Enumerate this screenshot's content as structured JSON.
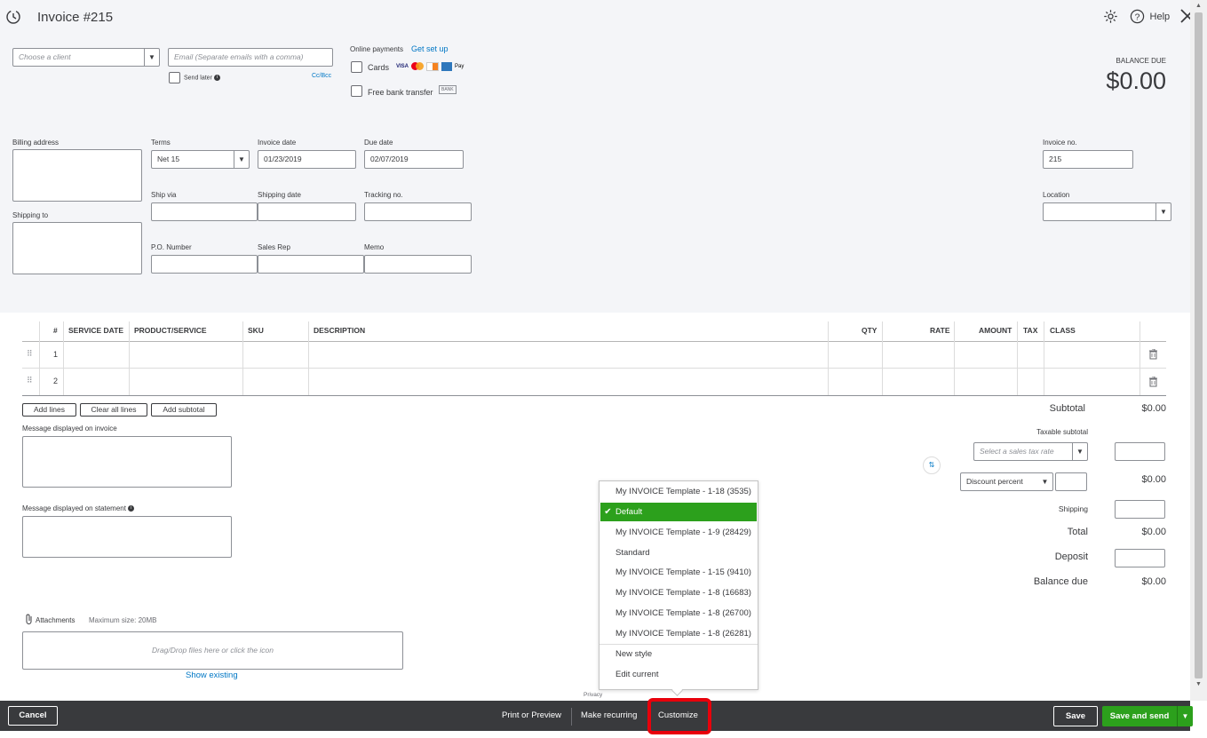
{
  "header": {
    "title": "Invoice #215",
    "help_label": "Help"
  },
  "customer": {
    "client_placeholder": "Choose a client",
    "email_placeholder": "Email (Separate emails with a comma)",
    "send_later_label": "Send later",
    "cc_bcc_label": "Cc/Bcc"
  },
  "online_payments": {
    "label": "Online payments",
    "setup_link": "Get set up",
    "cards_label": "Cards",
    "bank_label": "Free bank transfer",
    "bank_badge": "BANK",
    "card_brands": [
      "VISA",
      "MC",
      "DISC",
      "AMEX",
      "Pay"
    ]
  },
  "balance": {
    "label": "BALANCE DUE",
    "amount": "$0.00"
  },
  "fields": {
    "billing_address_label": "Billing address",
    "shipping_to_label": "Shipping to",
    "terms_label": "Terms",
    "terms_value": "Net 15",
    "invoice_date_label": "Invoice date",
    "invoice_date_value": "01/23/2019",
    "due_date_label": "Due date",
    "due_date_value": "02/07/2019",
    "ship_via_label": "Ship via",
    "shipping_date_label": "Shipping date",
    "tracking_label": "Tracking no.",
    "po_label": "P.O. Number",
    "sales_rep_label": "Sales Rep",
    "memo_label": "Memo",
    "invoice_no_label": "Invoice no.",
    "invoice_no_value": "215",
    "location_label": "Location"
  },
  "table": {
    "headers": [
      "#",
      "SERVICE DATE",
      "PRODUCT/SERVICE",
      "SKU",
      "DESCRIPTION",
      "QTY",
      "RATE",
      "AMOUNT",
      "TAX",
      "CLASS"
    ],
    "rows": [
      "1",
      "2"
    ]
  },
  "actions": {
    "add_lines": "Add lines",
    "clear_all_lines": "Clear all lines",
    "add_subtotal": "Add subtotal"
  },
  "messages": {
    "invoice_label": "Message displayed on invoice",
    "statement_label": "Message displayed on statement"
  },
  "attachments": {
    "label": "Attachments",
    "max_size": "Maximum size: 20MB",
    "drop_text": "Drag/Drop files here or click the icon",
    "show_existing": "Show existing"
  },
  "totals": {
    "subtotal_label": "Subtotal",
    "subtotal_value": "$0.00",
    "taxable_subtotal_label": "Taxable subtotal",
    "tax_rate_placeholder": "Select a sales tax rate",
    "discount_type": "Discount percent",
    "discount_value": "$0.00",
    "shipping_label": "Shipping",
    "total_label": "Total",
    "total_value": "$0.00",
    "deposit_label": "Deposit",
    "balance_due_label": "Balance due",
    "balance_due_value": "$0.00"
  },
  "style_menu": {
    "items": [
      "My INVOICE Template - 1-18 (3535)",
      "Default",
      "My INVOICE Template - 1-9 (28429)",
      "Standard",
      "My INVOICE Template - 1-15 (9410)",
      "My INVOICE Template - 1-8 (16683)",
      "My INVOICE Template - 1-8 (26700)",
      "My INVOICE Template - 1-8 (26281)"
    ],
    "selected": "Default",
    "new_style": "New style",
    "edit_current": "Edit current",
    "privacy": "Privacy"
  },
  "footer": {
    "cancel": "Cancel",
    "print_preview": "Print or Preview",
    "make_recurring": "Make recurring",
    "customize": "Customize",
    "save": "Save",
    "save_and_send": "Save and send"
  },
  "colors": {
    "accent_green": "#2ca01c",
    "link_blue": "#0077c5",
    "footer_bg": "#393a3d",
    "highlight_red": "#e8000b"
  }
}
